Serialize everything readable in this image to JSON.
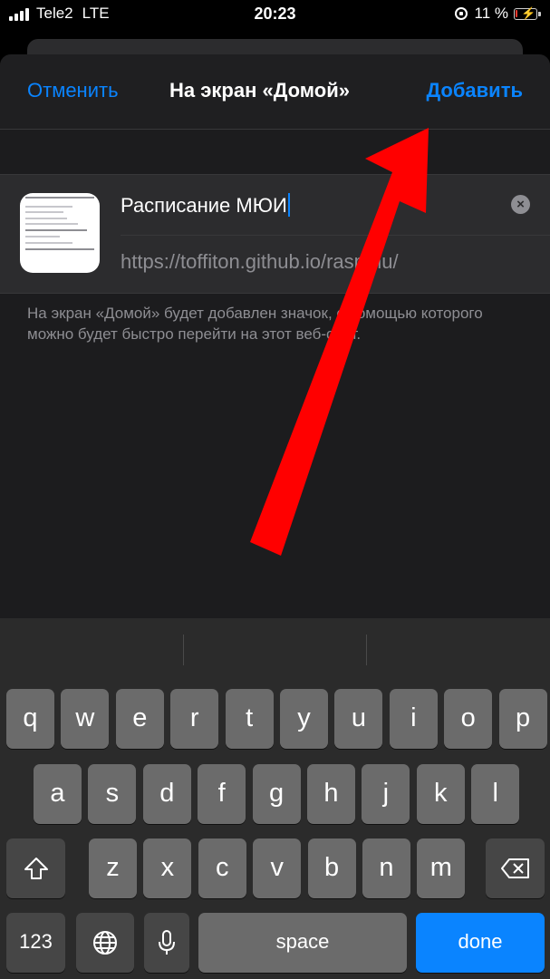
{
  "status_bar": {
    "carrier": "Tele2",
    "network": "LTE",
    "time": "20:23",
    "battery_percent": "11 %",
    "battery_level": 0.11
  },
  "sheet": {
    "cancel_label": "Отменить",
    "title": "На экран «Домой»",
    "add_label": "Добавить",
    "name_value": "Расписание МЮИ",
    "url_value": "https://toffiton.github.io/raspmu/",
    "hint": "На экран «Домой» будет добавлен значок, с помощью которого можно будет быстро перейти на этот веб-сайт."
  },
  "keyboard": {
    "row1": [
      "q",
      "w",
      "e",
      "r",
      "t",
      "y",
      "u",
      "i",
      "o",
      "p"
    ],
    "row2": [
      "a",
      "s",
      "d",
      "f",
      "g",
      "h",
      "j",
      "k",
      "l"
    ],
    "row3": [
      "z",
      "x",
      "c",
      "v",
      "b",
      "n",
      "m"
    ],
    "num_label": "123",
    "space_label": "space",
    "done_label": "done"
  },
  "colors": {
    "accent": "#0a84ff",
    "arrow": "#ff0000"
  }
}
